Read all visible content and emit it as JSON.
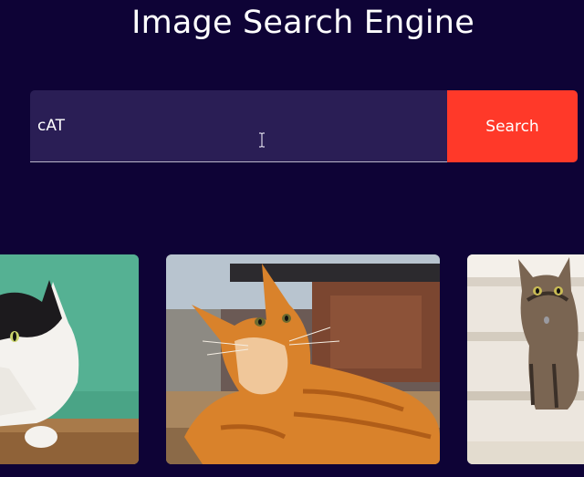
{
  "page": {
    "title": "Image Search Engine"
  },
  "search": {
    "value": "cAT",
    "button_label": "Search"
  },
  "results": {
    "images": [
      {
        "subject": "white-and-black-cat"
      },
      {
        "subject": "orange-tabby-cat"
      },
      {
        "subject": "tabby-cat-on-stairs"
      }
    ]
  },
  "colors": {
    "background": "#0e0336",
    "input_background": "#2a1e55",
    "button": "#ff3929",
    "text": "#ffffff"
  }
}
